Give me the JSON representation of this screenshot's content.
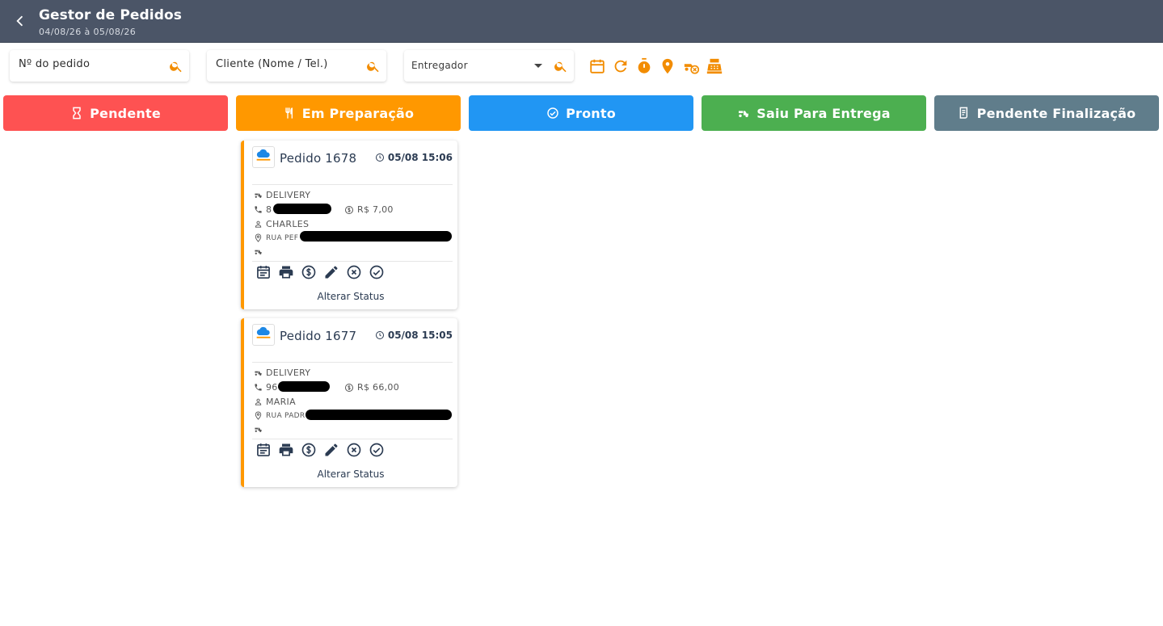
{
  "header": {
    "title": "Gestor de Pedidos",
    "date_range": "04/08/26 à 05/08/26"
  },
  "filters": {
    "order_number_placeholder": "Nº do pedido",
    "client_placeholder": "Cliente (Nome / Tel.)",
    "deliverer_label": "Entregador"
  },
  "toolbar_icons": [
    "calendar-icon",
    "refresh-icon",
    "timer-icon",
    "location-pin-icon",
    "delivery-cancel-icon",
    "cash-register-icon"
  ],
  "status_tabs": [
    {
      "label": "Pendente",
      "color": "#fe5252",
      "icon": "hourglass-icon"
    },
    {
      "label": "Em Preparação",
      "color": "#ff9800",
      "icon": "cutlery-icon"
    },
    {
      "label": "Pronto",
      "color": "#2196f3",
      "icon": "check-circle-icon"
    },
    {
      "label": "Saiu Para Entrega",
      "color": "#4caf50",
      "icon": "scooter-icon"
    },
    {
      "label": "Pendente Finalização",
      "color": "#607d8b",
      "icon": "receipt-icon"
    }
  ],
  "accent_color": "#ff9800",
  "orders": [
    {
      "title": "Pedido 1678",
      "time": "05/08 15:06",
      "type": "DELIVERY",
      "phone_prefix": "8",
      "value": "R$ 7,00",
      "customer": "CHARLES",
      "address_prefix": "RUA PEF",
      "alter_status": "Alterar Status"
    },
    {
      "title": "Pedido 1677",
      "time": "05/08 15:05",
      "type": "DELIVERY",
      "phone_prefix": "96",
      "value": "R$ 66,00",
      "customer": "MARIA",
      "address_prefix": "RUA PADR",
      "alter_status": "Alterar Status"
    }
  ]
}
